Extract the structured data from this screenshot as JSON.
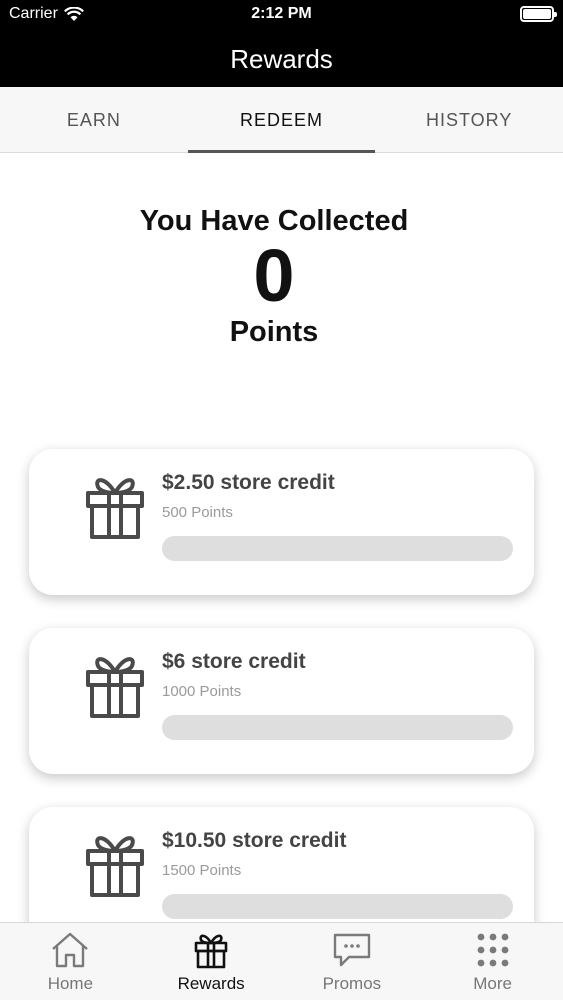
{
  "status_bar": {
    "carrier": "Carrier",
    "time": "2:12 PM"
  },
  "nav": {
    "title": "Rewards"
  },
  "tabs": [
    {
      "label": "EARN",
      "active": false
    },
    {
      "label": "REDEEM",
      "active": true
    },
    {
      "label": "HISTORY",
      "active": false
    }
  ],
  "summary": {
    "title": "You Have Collected",
    "value": "0",
    "unit": "Points"
  },
  "rewards": [
    {
      "title": "$2.50 store credit",
      "points": "500 Points",
      "progress": 0,
      "icon": "gift-icon"
    },
    {
      "title": "$6 store credit",
      "points": "1000 Points",
      "progress": 0,
      "icon": "gift-icon"
    },
    {
      "title": "$10.50 store credit",
      "points": "1500 Points",
      "progress": 0,
      "icon": "gift-icon"
    }
  ],
  "tab_bar": [
    {
      "label": "Home",
      "icon": "home-icon",
      "active": false
    },
    {
      "label": "Rewards",
      "icon": "gift-icon",
      "active": true
    },
    {
      "label": "Promos",
      "icon": "chat-bubble-icon",
      "active": false
    },
    {
      "label": "More",
      "icon": "grid-dots-icon",
      "active": false
    }
  ],
  "colors": {
    "bar_bg": "#000000",
    "tab_bg": "#f7f7f7",
    "progress_track": "#dedede",
    "text_dark": "#111111"
  }
}
